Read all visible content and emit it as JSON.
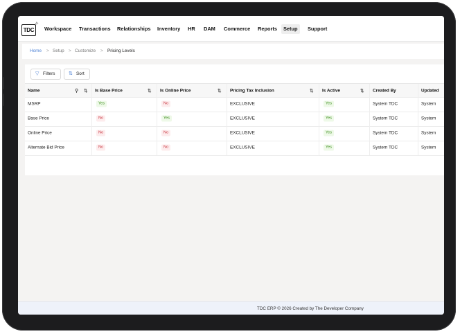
{
  "nav": {
    "logo": "TDC",
    "items": [
      {
        "label": "Workspace",
        "active": false
      },
      {
        "label": "Transactions",
        "active": false
      },
      {
        "label": "Relationships",
        "active": false
      },
      {
        "label": "Inventory",
        "active": false
      },
      {
        "label": "HR",
        "active": false
      },
      {
        "label": "DAM",
        "active": false
      },
      {
        "label": "Commerce",
        "active": false
      },
      {
        "label": "Reports",
        "active": false
      },
      {
        "label": "Setup",
        "active": true
      },
      {
        "label": "Support",
        "active": false
      }
    ]
  },
  "breadcrumb": {
    "items": [
      "Home",
      "Setup",
      "Customize",
      "Pricing Levels"
    ],
    "separator": ">"
  },
  "toolbar": {
    "filters_label": "Filters",
    "sort_label": "Sort"
  },
  "table": {
    "columns": [
      "Name",
      "Is Base Price",
      "Is Online Price",
      "Pricing Tax Inclusion",
      "Is Active",
      "Created By",
      "Updated"
    ],
    "rows": [
      {
        "name": "MSRP",
        "is_base_price": "Yes",
        "is_online_price": "No",
        "tax_inclusion": "EXCLUSIVE",
        "is_active": "Yes",
        "created_by": "System TDC",
        "updated_by": "System"
      },
      {
        "name": "Base Price",
        "is_base_price": "No",
        "is_online_price": "Yes",
        "tax_inclusion": "EXCLUSIVE",
        "is_active": "Yes",
        "created_by": "System TDC",
        "updated_by": "System"
      },
      {
        "name": "Online Price",
        "is_base_price": "No",
        "is_online_price": "No",
        "tax_inclusion": "EXCLUSIVE",
        "is_active": "Yes",
        "created_by": "System TDC",
        "updated_by": "System"
      },
      {
        "name": "Alternate Bid Price",
        "is_base_price": "No",
        "is_online_price": "No",
        "tax_inclusion": "EXCLUSIVE",
        "is_active": "Yes",
        "created_by": "System TDC",
        "updated_by": "System"
      }
    ]
  },
  "footer": {
    "text": "TDC ERP © 2026 Created by The Developer Company"
  },
  "colors": {
    "accent": "#4a7fd4",
    "yes_text": "#3a8d1a",
    "yes_bg": "#eef9e8",
    "no_text": "#c8343d",
    "no_bg": "#fdeced"
  },
  "icons": {
    "filter": "funnel-icon",
    "sort": "sort-arrows-icon",
    "search": "search-icon"
  }
}
